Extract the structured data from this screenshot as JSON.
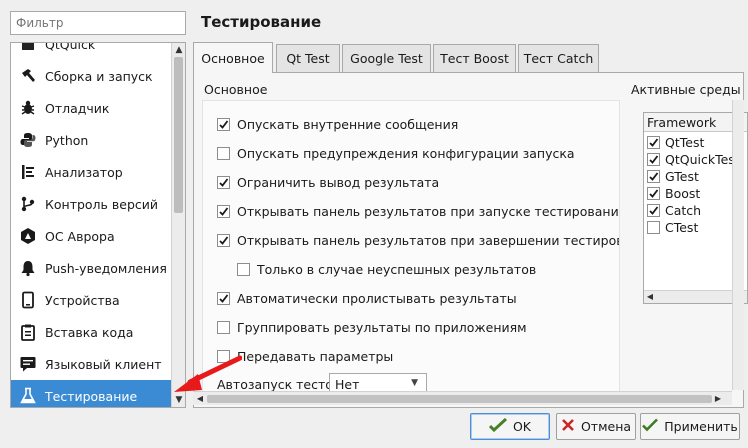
{
  "filter": {
    "placeholder": "Фильтр"
  },
  "sidebar": {
    "items": [
      {
        "label": "QtQuick",
        "icon": "qtquick-icon"
      },
      {
        "label": "Сборка и запуск",
        "icon": "hammer-icon"
      },
      {
        "label": "Отладчик",
        "icon": "bug-icon"
      },
      {
        "label": "Python",
        "icon": "python-icon"
      },
      {
        "label": "Анализатор",
        "icon": "analyzer-icon"
      },
      {
        "label": "Контроль версий",
        "icon": "version-control-icon"
      },
      {
        "label": "ОС Аврора",
        "icon": "aurora-icon"
      },
      {
        "label": "Push-уведомления",
        "icon": "bell-icon"
      },
      {
        "label": "Устройства",
        "icon": "device-icon"
      },
      {
        "label": "Вставка кода",
        "icon": "clipboard-icon"
      },
      {
        "label": "Языковый клиент",
        "icon": "chat-icon"
      },
      {
        "label": "Тестирование",
        "icon": "flask-icon"
      }
    ],
    "selected_index": 11
  },
  "page": {
    "title": "Тестирование"
  },
  "tabs": [
    {
      "label": "Основное",
      "active": true
    },
    {
      "label": "Qt Test"
    },
    {
      "label": "Google Test"
    },
    {
      "label": "Тест Boost"
    },
    {
      "label": "Тест Catch"
    }
  ],
  "general": {
    "section_title": "Основное",
    "options": [
      {
        "label": "Опускать внутренние сообщения",
        "checked": true
      },
      {
        "label": "Опускать предупреждения конфигурации запуска",
        "checked": false
      },
      {
        "label": "Ограничить вывод результата",
        "checked": true
      },
      {
        "label": "Открывать панель результатов при запуске тестирования",
        "checked": true
      },
      {
        "label": "Открывать панель результатов при завершении тестирования",
        "checked": true
      },
      {
        "label": "Только в случае неуспешных результатов",
        "checked": false
      },
      {
        "label": "Автоматически пролистывать результаты",
        "checked": true
      },
      {
        "label": "Группировать результаты по приложениям",
        "checked": false
      },
      {
        "label": "Передавать параметры",
        "checked": false
      }
    ],
    "autorun_label": "Автозапуск тестов",
    "autorun_value": "Нет"
  },
  "frameworks": {
    "title": "Активные среды",
    "header": "Framework",
    "items": [
      {
        "label": "QtTest",
        "checked": true
      },
      {
        "label": "QtQuickTest",
        "checked": true
      },
      {
        "label": "GTest",
        "checked": true
      },
      {
        "label": "Boost",
        "checked": true
      },
      {
        "label": "Catch",
        "checked": true
      },
      {
        "label": "CTest",
        "checked": false
      }
    ]
  },
  "buttons": {
    "ok": "OK",
    "cancel": "Отмена",
    "apply": "Применить"
  },
  "colors": {
    "selection": "#3a8bd3",
    "annotation_arrow": "#e8191b"
  }
}
